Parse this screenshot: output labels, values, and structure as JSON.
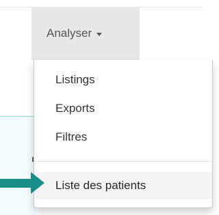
{
  "nav": {
    "tab_label": "Analyser"
  },
  "dropdown": {
    "items": [
      {
        "label": "Listings"
      },
      {
        "label": "Exports"
      },
      {
        "label": "Filtres"
      }
    ],
    "highlighted_item": {
      "label": "Liste des patients"
    }
  },
  "annotation": {
    "arrow_color": "#1a8f8a",
    "arrow_icon": "right-arrow-icon"
  },
  "colors": {
    "tab_background": "#e7e7e7",
    "accent_line": "#88d8e0"
  }
}
